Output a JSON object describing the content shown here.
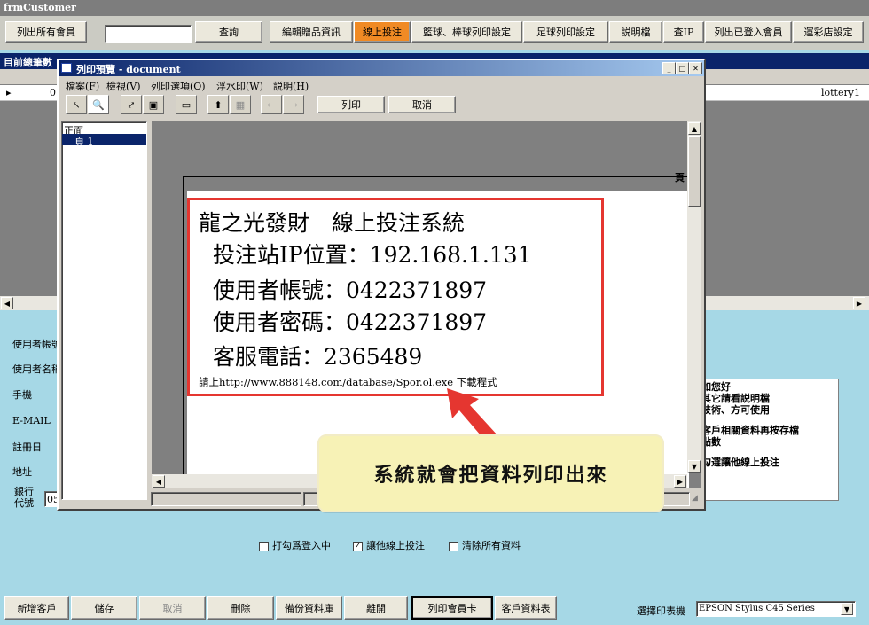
{
  "window": {
    "title": "frmCustomer"
  },
  "toolbar": {
    "list_members": "列出所有會員",
    "search_value": "",
    "query": "查詢",
    "edit_gift": "編輯贈品資訊",
    "online_bet": "線上投注",
    "basketball_print": "籃球、棒球列印設定",
    "soccer_print": "足球列印設定",
    "manual": "説明檔",
    "check_ip": "查IP",
    "list_logged": "列出已登入會員",
    "lottery_settings": "運彩店設定"
  },
  "grid": {
    "header": "目前總筆數",
    "row_indicator": "▸",
    "row_first": "0",
    "row_last": "lottery1"
  },
  "form": {
    "username": "使用者帳號",
    "name": "使用者名稱",
    "phone": "手機",
    "email": "E-MAIL",
    "register_date": "註冊日",
    "address": "地址",
    "bank_code": "銀行\n代號",
    "bank_value": "05"
  },
  "note": {
    "line1": "如您好",
    "line2": "其它請看説明檔",
    "line3": "技術、方可使用",
    "line4": "客戶相關資料再按存檔",
    "line5": "點數",
    "line6": "勾選讓他線上投注"
  },
  "checkboxes": [
    {
      "label": "打勾爲登入中",
      "checked": false
    },
    {
      "label": "讓他線上投注",
      "checked": true
    },
    {
      "label": "清除所有資料",
      "checked": false
    }
  ],
  "bottom": {
    "new_customer": "新增客戶",
    "save": "儲存",
    "cancel": "取消",
    "delete": "刪除",
    "backup": "備份資料庫",
    "close": "離開",
    "print_card": "列印會員卡",
    "customer_data": "客戶資料表",
    "printer_label": "選擇印表機",
    "printer_value": "EPSON Stylus C45 Series"
  },
  "dialog": {
    "title": "列印預覽 - document",
    "menu": [
      "檔案(F)",
      "檢視(V)",
      "列印選項(O)",
      "浮水印(W)",
      "説明(H)"
    ],
    "print_btn": "列印",
    "cancel_btn": "取消",
    "tree_root": "正面",
    "tree_page": "頁 1",
    "page_label": "頁",
    "doc": {
      "line1": "龍之光發財　線上投注系統",
      "line2": "投注站IP位置：192.168.1.131",
      "line3": "使用者帳號：0422371897",
      "line4": "使用者密碼：0422371897",
      "line5": "客服電話：2365489",
      "line6": "請上http://www.888148.com/database/Spor.ol.exe 下載程式"
    }
  },
  "callout": {
    "text": "系統就會把資料列印出來"
  },
  "colors": {
    "form_bg": "#a6d8e6",
    "title_bar": "#0a246a",
    "highlight": "#f08a24",
    "callout_bg": "#f7f2b6",
    "red": "#e53630"
  }
}
